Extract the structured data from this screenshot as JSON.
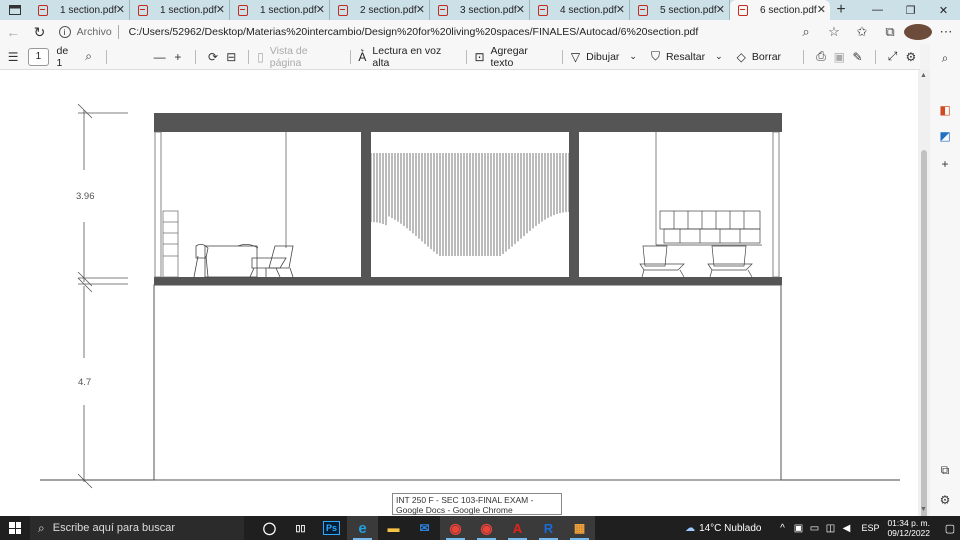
{
  "browser": {
    "tabs": [
      {
        "label": "1 section.pdf"
      },
      {
        "label": "1 section.pdf"
      },
      {
        "label": "1 section.pdf"
      },
      {
        "label": "2 section.pdf"
      },
      {
        "label": "3 section.pdf"
      },
      {
        "label": "4 section.pdf"
      },
      {
        "label": "5 section.pdf"
      },
      {
        "label": "6 section.pdf"
      }
    ],
    "active_tab_index": 7,
    "new_tab_glyph": "+",
    "window_controls": {
      "minimize": "—",
      "maximize": "❐",
      "close": "✕"
    },
    "address": {
      "scheme_label": "Archivo",
      "url": "C:/Users/52962/Desktop/Materias%20intercambio/Design%20for%20living%20spaces/FINALES/Autocad/6%20section.pdf"
    }
  },
  "pdf_toolbar": {
    "page_current": "1",
    "page_total": "de 1",
    "page_view_label": "Vista de página",
    "read_aloud_label": "Lectura en voz alta",
    "add_text_label": "Agregar texto",
    "draw_label": "Dibujar",
    "highlight_label": "Resaltar",
    "erase_label": "Borrar"
  },
  "drawing": {
    "dim_upper": "3.96",
    "dim_lower": "4.7"
  },
  "tooltip": {
    "text": "INT 250 F - SEC 103-FINAL EXAM - Google Docs - Google Chrome"
  },
  "taskbar": {
    "search_placeholder": "Escribe aquí para buscar",
    "weather": "14°C  Nublado",
    "language": "ESP",
    "time": "01:34 p. m.",
    "date": "09/12/2022",
    "apps": [
      {
        "name": "task-view",
        "glyph": "◯"
      },
      {
        "name": "multitasking",
        "glyph": "▯▯"
      },
      {
        "name": "photoshop",
        "glyph": "Ps"
      },
      {
        "name": "edge",
        "glyph": "e"
      },
      {
        "name": "file-explorer",
        "glyph": "▬"
      },
      {
        "name": "mail",
        "glyph": "✉"
      },
      {
        "name": "chrome-1",
        "glyph": "◉"
      },
      {
        "name": "chrome-2",
        "glyph": "◉"
      },
      {
        "name": "autocad",
        "glyph": "A"
      },
      {
        "name": "revit",
        "glyph": "R"
      },
      {
        "name": "calculator",
        "glyph": "▦"
      }
    ]
  },
  "colors": {
    "tab_bar": "#cce0e8",
    "pdf_icon": "#c42b1c",
    "slab": "#555555",
    "taskbar": "#1f1f1f",
    "photoshop": "#31a8ff",
    "edge": "#1fa0e0",
    "explorer": "#f6c445",
    "mail": "#2f7fd8",
    "chrome": "#e9443a",
    "autocad": "#e2231a",
    "revit": "#186bd6",
    "calculator": "#f3a13b"
  }
}
